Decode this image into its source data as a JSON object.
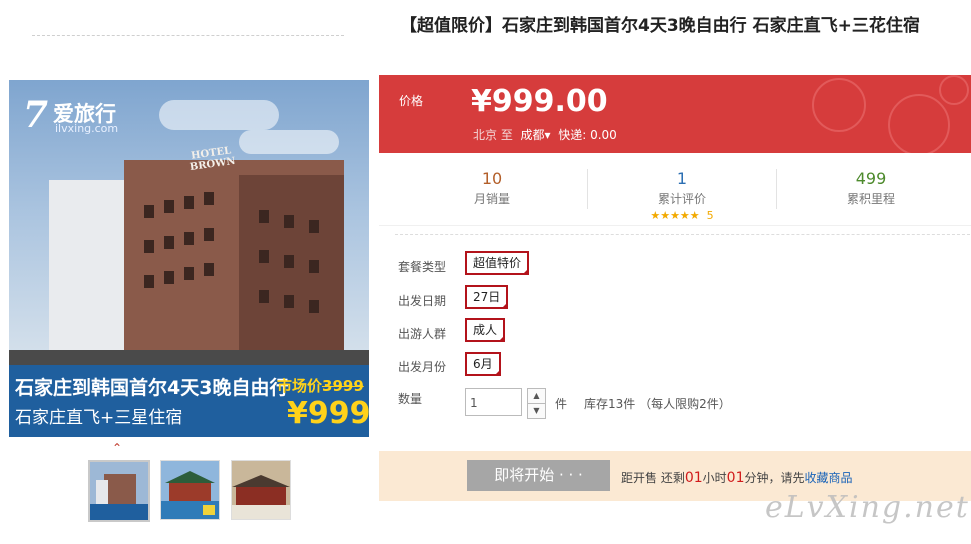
{
  "product": {
    "title": "【超值限价】石家庄到韩国首尔4天3晚自由行 石家庄直飞+三花住宿"
  },
  "image": {
    "logo_mark": "7",
    "logo_title": "爱旅行",
    "logo_sub": "ilvxing.com",
    "hotel_sign": "HOTEL BROWN",
    "banner_title": "石家庄到韩国首尔4天3晚自由行",
    "banner_sub": "石家庄直飞+三星住宿",
    "banner_market_label": "市场价",
    "banner_market_value": "3999",
    "banner_price": "¥999"
  },
  "thumbnails": {
    "up_arrow": "^",
    "items": [
      {
        "name": "thumbnail-hotel",
        "active": true
      },
      {
        "name": "thumbnail-palace",
        "active": false
      },
      {
        "name": "thumbnail-street",
        "active": false
      }
    ]
  },
  "price": {
    "label": "价格",
    "value": "¥999.00",
    "from": "北京",
    "to_word": "至",
    "dest": "成都",
    "dest_arrow": "▾",
    "shipping_label": "快递:",
    "shipping_value": "0.00",
    "color": "#d63c3c"
  },
  "stats": [
    {
      "num": "10",
      "label": "月销量",
      "color": "#b35f2a"
    },
    {
      "num": "1",
      "label": "累计评价",
      "color": "#2c6fb3",
      "stars": "★★★★★",
      "rating": "5"
    },
    {
      "num": "499",
      "label": "累积里程",
      "color": "#4d8a2c"
    }
  ],
  "options": [
    {
      "label": "套餐类型",
      "value": "超值特价"
    },
    {
      "label": "出发日期",
      "value": "27日"
    },
    {
      "label": "出游人群",
      "value": "成人"
    },
    {
      "label": "出发月份",
      "value": "6月"
    }
  ],
  "quantity": {
    "label": "数量",
    "value": "1",
    "up": "▲",
    "down": "▼",
    "unit": "件",
    "stock": "库存13件 （每人限购2件）"
  },
  "buy": {
    "button": "即将开始 · · ·",
    "prefix": "距开售 还剩",
    "hours": "01",
    "hours_unit": "小时",
    "minutes": "01",
    "minutes_unit": "分钟，请先",
    "favorite": "收藏商品"
  },
  "watermark": "eLvXing.net"
}
